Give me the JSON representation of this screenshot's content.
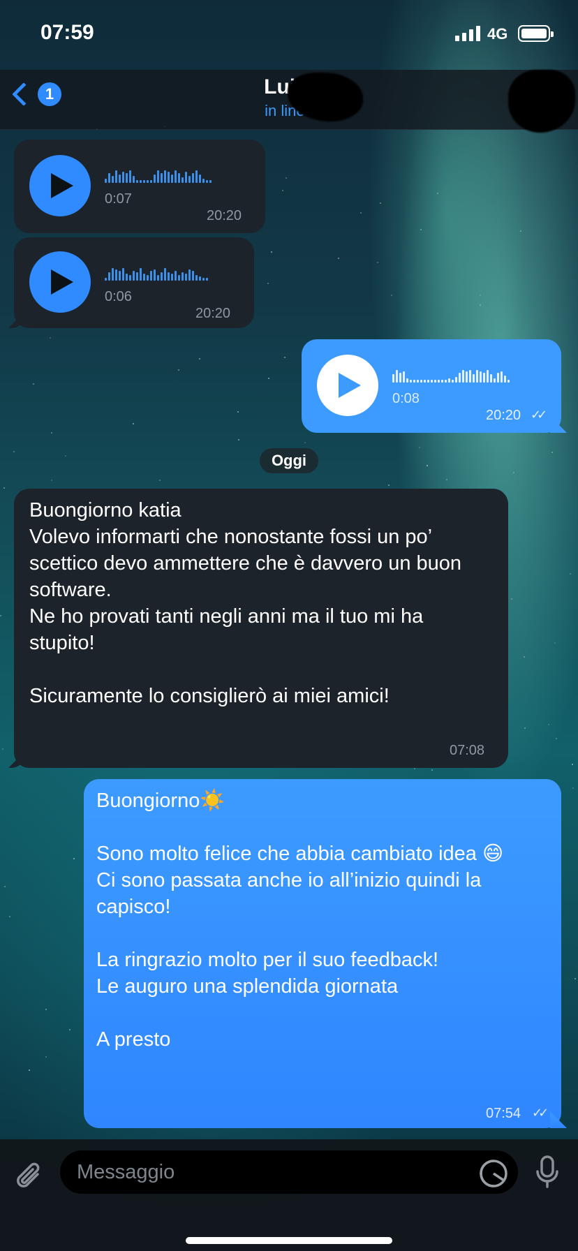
{
  "status_bar": {
    "time": "07:59",
    "network": "4G"
  },
  "header": {
    "back_badge": "1",
    "title": "Luigi",
    "status": "in linea"
  },
  "messages": {
    "voice1": {
      "duration": "0:07",
      "time": "20:20"
    },
    "voice2": {
      "duration": "0:06",
      "time": "20:20"
    },
    "voice3": {
      "duration": "0:08",
      "time": "20:20",
      "ticks": "✓✓"
    },
    "date_separator": "Oggi",
    "text_in": {
      "text": "Buongiorno katia\nVolevo informarti che nonostante fossi un po’ scettico devo ammettere che è davvero un buon software.\nNe ho provati tanti negli anni ma il tuo mi ha stupito!\n\nSicuramente lo consiglierò ai miei amici!",
      "time": "07:08"
    },
    "text_out": {
      "text": "Buongiorno☀️\n\nSono molto felice che abbia cambiato idea 😄\nCi sono passata anche io all’inizio quindi la capisco!\n\nLa ringrazio molto per il suo feedback!\nLe auguro una splendida giornata\n\nA presto",
      "time": "07:54",
      "ticks": "✓✓"
    }
  },
  "input": {
    "placeholder": "Messaggio"
  },
  "colors": {
    "accent": "#2f8bff",
    "incoming_bubble": "#1c232a",
    "outgoing_bubble": "#3d9bff"
  }
}
